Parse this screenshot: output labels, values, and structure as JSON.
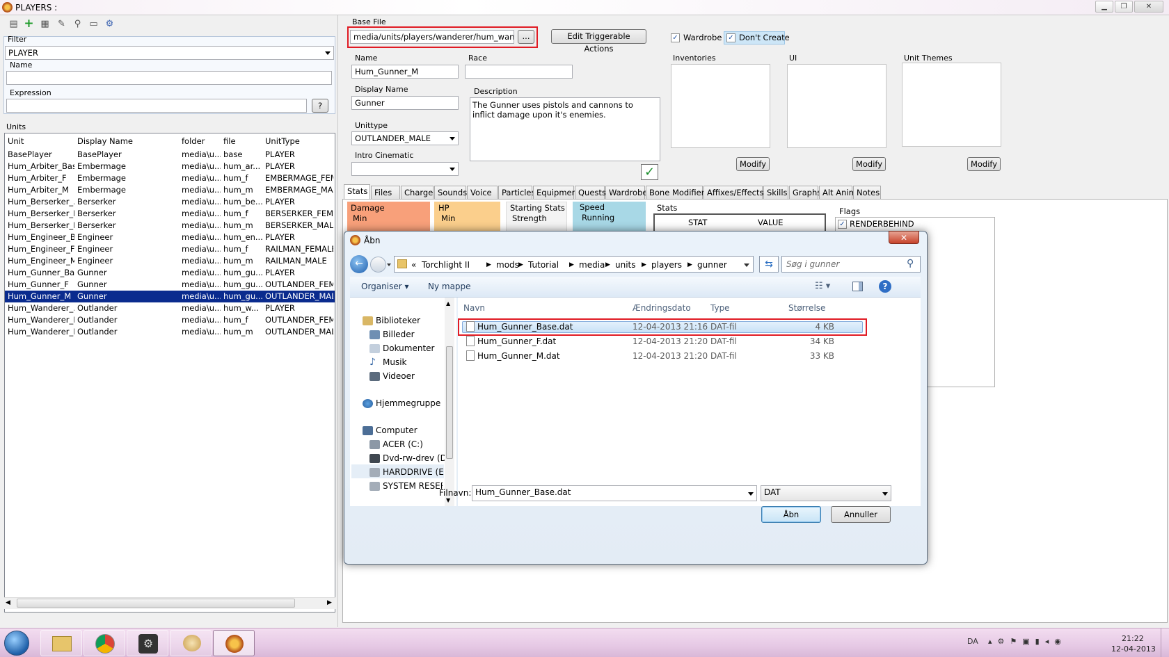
{
  "window": {
    "title": "PLAYERS :"
  },
  "left": {
    "filter_label": "Filter",
    "filter_value": "PLAYER",
    "name_label": "Name",
    "expression_label": "Expression",
    "expression_btn": "?",
    "units_label": "Units",
    "columns": [
      "Unit",
      "Display Name",
      "folder",
      "file",
      "UnitType"
    ],
    "rows": [
      [
        "BasePlayer",
        "BasePlayer",
        "media\\u...",
        "base",
        "PLAYER"
      ],
      [
        "Hum_Arbiter_Base",
        "Embermage",
        "media\\u...",
        "hum_ar...",
        "PLAYER"
      ],
      [
        "Hum_Arbiter_F",
        "Embermage",
        "media\\u...",
        "hum_f",
        "EMBERMAGE_FEMA"
      ],
      [
        "Hum_Arbiter_M",
        "Embermage",
        "media\\u...",
        "hum_m",
        "EMBERMAGE_MALE"
      ],
      [
        "Hum_Berserker_...",
        "Berserker",
        "media\\u...",
        "hum_be...",
        "PLAYER"
      ],
      [
        "Hum_Berserker_F",
        "Berserker",
        "media\\u...",
        "hum_f",
        "BERSERKER_FEMA"
      ],
      [
        "Hum_Berserker_M",
        "Berserker",
        "media\\u...",
        "hum_m",
        "BERSERKER_MALE"
      ],
      [
        "Hum_Engineer_B...",
        "Engineer",
        "media\\u...",
        "hum_en...",
        "PLAYER"
      ],
      [
        "Hum_Engineer_F",
        "Engineer",
        "media\\u...",
        "hum_f",
        "RAILMAN_FEMALE"
      ],
      [
        "Hum_Engineer_M",
        "Engineer",
        "media\\u...",
        "hum_m",
        "RAILMAN_MALE"
      ],
      [
        "Hum_Gunner_Ba...",
        "Gunner",
        "media\\u...",
        "hum_gu...",
        "PLAYER"
      ],
      [
        "Hum_Gunner_F",
        "Gunner",
        "media\\u...",
        "hum_gu...",
        "OUTLANDER_FEMA"
      ],
      [
        "Hum_Gunner_M",
        "Gunner",
        "media\\u...",
        "hum_gu...",
        "OUTLANDER_MALE"
      ],
      [
        "Hum_Wanderer_...",
        "Outlander",
        "media\\u...",
        "hum_w...",
        "PLAYER"
      ],
      [
        "Hum_Wanderer_F",
        "Outlander",
        "media\\u...",
        "hum_f",
        "OUTLANDER_FEMA"
      ],
      [
        "Hum_Wanderer_M",
        "Outlander",
        "media\\u...",
        "hum_m",
        "OUTLANDER_MALE"
      ]
    ],
    "selected_row": 12
  },
  "right": {
    "base_file_label": "Base File",
    "base_file_value": "media/units/players/wanderer/hum_wanderer_b",
    "browse_btn": "...",
    "edit_triggerable": "Edit Triggerable Actions",
    "wardrobe": "Wardrobe",
    "dont_create": "Don't Create",
    "name_label": "Name",
    "name_value": "Hum_Gunner_M",
    "race_label": "Race",
    "display_name_label": "Display Name",
    "display_name_value": "Gunner",
    "description_label": "Description",
    "description_value": "The Gunner uses pistols and cannons to inflict damage upon it's enemies.",
    "unittype_label": "Unittype",
    "unittype_value": "OUTLANDER_MALE",
    "intro_label": "Intro Cinematic",
    "inventories_label": "Inventories",
    "ui_label": "UI",
    "unit_themes_label": "Unit Themes",
    "modify": "Modify",
    "tabs": [
      "Stats",
      "Files",
      "Charge",
      "Sounds",
      "Voice",
      "Particles",
      "Equipment",
      "Quests",
      "Wardrobe",
      "Bone Modifiers",
      "Affixes/Effects",
      "Skills",
      "Graphs",
      "Alt Anim",
      "Notes"
    ],
    "stats": {
      "damage": "Damage",
      "min": "Min",
      "hp": "HP",
      "hp_min": "Min",
      "starting": "Starting Stats",
      "strength": "Strength",
      "speed": "Speed",
      "running": "Running",
      "stats": "Stats",
      "stat_col": "STAT",
      "value_col": "VALUE",
      "flags": "Flags",
      "renderbehind": "RENDERBEHIND"
    }
  },
  "dialog": {
    "title": "Åbn",
    "crumbs": [
      "«",
      "Torchlight II",
      "mods",
      "Tutorial",
      "media",
      "units",
      "players",
      "gunner"
    ],
    "search_placeholder": "Søg i gunner",
    "organise": "Organiser",
    "new_folder": "Ny mappe",
    "nav": {
      "libraries": "Biblioteker",
      "pictures": "Billeder",
      "documents": "Dokumenter",
      "music": "Musik",
      "videos": "Videoer",
      "homegroup": "Hjemmegruppe",
      "computer": "Computer",
      "acer": "ACER (C:)",
      "dvd": "Dvd-rw-drev (D:)",
      "harddrive": "HARDDRIVE (E:)",
      "system": "SYSTEM RESERVE"
    },
    "columns": [
      "Navn",
      "Ændringsdato",
      "Type",
      "Størrelse"
    ],
    "files": [
      [
        "Hum_Gunner_Base.dat",
        "12-04-2013 21:16",
        "DAT-fil",
        "4 KB"
      ],
      [
        "Hum_Gunner_F.dat",
        "12-04-2013 21:20",
        "DAT-fil",
        "34 KB"
      ],
      [
        "Hum_Gunner_M.dat",
        "12-04-2013 21:20",
        "DAT-fil",
        "33 KB"
      ]
    ],
    "filename_label": "Filnavn:",
    "filename_value": "Hum_Gunner_Base.dat",
    "filetype": "DAT",
    "open_btn": "Åbn",
    "cancel_btn": "Annuller"
  },
  "taskbar": {
    "lang": "DA",
    "time": "21:22",
    "date": "12-04-2013"
  }
}
